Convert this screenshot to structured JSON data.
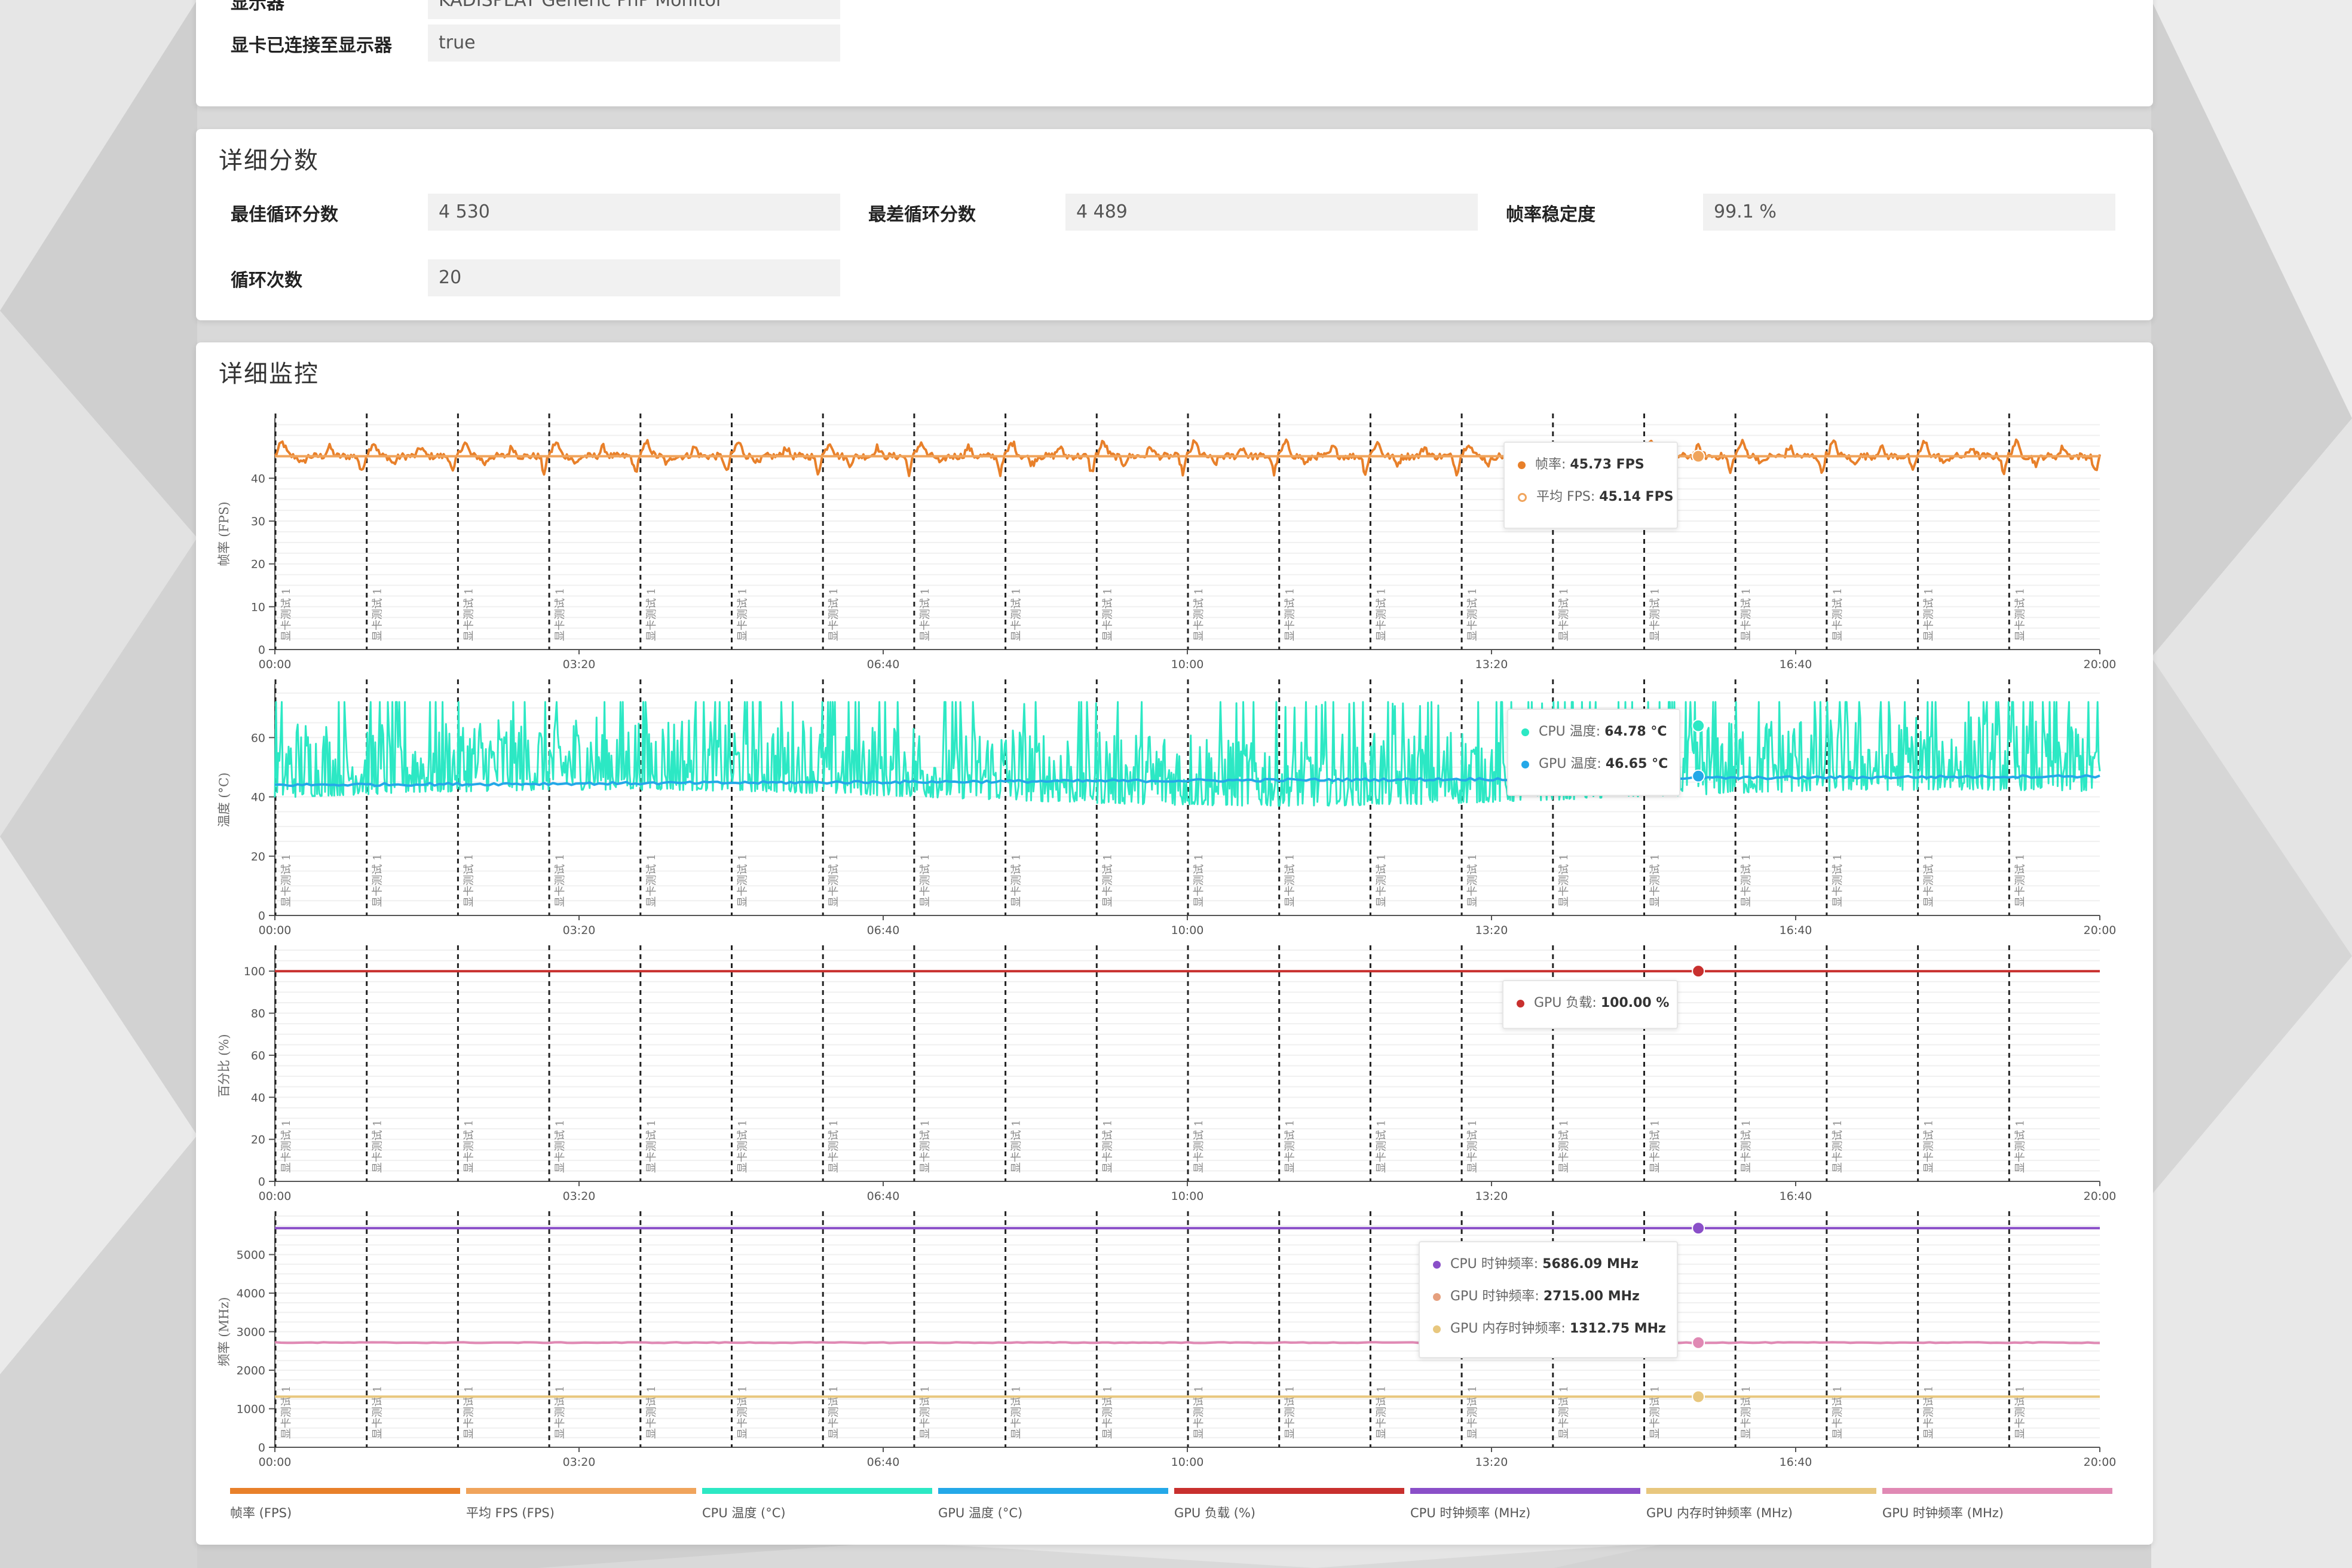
{
  "system_info": {
    "rows": [
      {
        "label": "显示器",
        "value": "KADISPLAY Generic PnP Monitor"
      },
      {
        "label": "显卡已连接至显示器",
        "value": "true"
      }
    ]
  },
  "detailed_scores": {
    "title": "详细分数",
    "fields": [
      {
        "label": "最佳循环分数",
        "value": "4 530"
      },
      {
        "label": "最差循环分数",
        "value": "4 489"
      },
      {
        "label": "帧率稳定度",
        "value": "99.1 %"
      },
      {
        "label": "循环次数",
        "value": "20"
      }
    ]
  },
  "monitoring": {
    "title": "详细监控",
    "marker_label": "显卡测试 1",
    "legend": [
      {
        "label": "帧率 (FPS)",
        "color": "#e8802a"
      },
      {
        "label": "平均 FPS (FPS)",
        "color": "#f0a45c"
      },
      {
        "label": "CPU 温度 (°C)",
        "color": "#2ce8c4"
      },
      {
        "label": "GPU 温度 (°C)",
        "color": "#24a8e8"
      },
      {
        "label": "GPU 负载 (%)",
        "color": "#c8302e"
      },
      {
        "label": "CPU 时钟频率 (MHz)",
        "color": "#8a4fc8"
      },
      {
        "label": "GPU 内存时钟频率 (MHz)",
        "color": "#e8c77e"
      },
      {
        "label": "GPU 时钟频率 (MHz)",
        "color": "#e089b4"
      }
    ],
    "tooltips": [
      {
        "rows": [
          {
            "name": "帧率",
            "value": "45.73 FPS",
            "color": "#e8802a",
            "ring": false
          },
          {
            "name": "平均 FPS",
            "value": "45.14 FPS",
            "color": "#f0a45c",
            "ring": true
          }
        ]
      },
      {
        "rows": [
          {
            "name": "CPU 温度",
            "value": "64.78 °C",
            "color": "#2ce8c4",
            "ring": false
          },
          {
            "name": "GPU 温度",
            "value": "46.65 °C",
            "color": "#24a8e8",
            "ring": false
          }
        ]
      },
      {
        "rows": [
          {
            "name": "GPU 负载",
            "value": "100.00 %",
            "color": "#c8302e",
            "ring": false
          }
        ]
      },
      {
        "rows": [
          {
            "name": "CPU 时钟频率",
            "value": "5686.09 MHz",
            "color": "#8a4fc8",
            "ring": false
          },
          {
            "name": "GPU 时钟频率",
            "value": "2715.00 MHz",
            "color": "#e6a07e",
            "ring": false
          },
          {
            "name": "GPU 内存时钟频率",
            "value": "1312.75 MHz",
            "color": "#e8c77e",
            "ring": false
          }
        ]
      }
    ]
  },
  "chart_data": [
    {
      "type": "line",
      "ylabel": "帧率 (FPS)",
      "ylim": [
        0,
        54
      ],
      "yticks": [
        0,
        10,
        20,
        30,
        40
      ],
      "xticks": [
        "00:00",
        "03:20",
        "06:40",
        "10:00",
        "13:20",
        "16:40",
        "20:00"
      ],
      "xlim_seconds": [
        0,
        1200
      ],
      "loop_markers_seconds": [
        0,
        60,
        120,
        180,
        240,
        300,
        360,
        420,
        480,
        540,
        600,
        660,
        720,
        780,
        840,
        900,
        960,
        1020,
        1080,
        1140
      ],
      "series": [
        {
          "name": "帧率",
          "color": "#e8802a",
          "pattern": "loop-wave",
          "mean": 45.14,
          "amplitude": 3.5
        },
        {
          "name": "平均 FPS",
          "color": "#f0a45c",
          "constant": 45.14
        }
      ],
      "hover_seconds": 936
    },
    {
      "type": "line",
      "ylabel": "温度 (°C)",
      "ylim": [
        0,
        78
      ],
      "yticks": [
        0,
        20,
        40,
        60
      ],
      "xticks": [
        "00:00",
        "03:20",
        "06:40",
        "10:00",
        "13:20",
        "16:40",
        "20:00"
      ],
      "xlim_seconds": [
        0,
        1200
      ],
      "loop_markers_seconds": [
        0,
        60,
        120,
        180,
        240,
        300,
        360,
        420,
        480,
        540,
        600,
        660,
        720,
        780,
        840,
        900,
        960,
        1020,
        1080,
        1140
      ],
      "series": [
        {
          "name": "CPU 温度",
          "color": "#2ce8c4",
          "pattern": "noisy",
          "low": 38,
          "high": 72
        },
        {
          "name": "GPU 温度",
          "color": "#24a8e8",
          "pattern": "slow-rise",
          "start": 44,
          "end": 47
        }
      ],
      "hover_seconds": 936
    },
    {
      "type": "line",
      "ylabel": "百分比 (%)",
      "ylim": [
        0,
        110
      ],
      "yticks": [
        0,
        20,
        40,
        60,
        80,
        100
      ],
      "xticks": [
        "00:00",
        "03:20",
        "06:40",
        "10:00",
        "13:20",
        "16:40",
        "20:00"
      ],
      "xlim_seconds": [
        0,
        1200
      ],
      "loop_markers_seconds": [
        0,
        60,
        120,
        180,
        240,
        300,
        360,
        420,
        480,
        540,
        600,
        660,
        720,
        780,
        840,
        900,
        960,
        1020,
        1080,
        1140
      ],
      "series": [
        {
          "name": "GPU 负载",
          "color": "#c8302e",
          "constant": 100
        }
      ],
      "hover_seconds": 936
    },
    {
      "type": "line",
      "ylabel": "频率 (MHz)",
      "ylim": [
        0,
        6000
      ],
      "yticks": [
        0,
        1000,
        2000,
        3000,
        4000,
        5000
      ],
      "xticks": [
        "00:00",
        "03:20",
        "06:40",
        "10:00",
        "13:20",
        "16:40",
        "20:00"
      ],
      "xlim_seconds": [
        0,
        1200
      ],
      "loop_markers_seconds": [
        0,
        60,
        120,
        180,
        240,
        300,
        360,
        420,
        480,
        540,
        600,
        660,
        720,
        780,
        840,
        900,
        960,
        1020,
        1080,
        1140
      ],
      "series": [
        {
          "name": "CPU 时钟频率",
          "color": "#8a4fc8",
          "constant": 5686.09
        },
        {
          "name": "GPU 时钟频率",
          "color": "#e089b4",
          "constant": 2715.0,
          "jitter": 20
        },
        {
          "name": "GPU 内存时钟频率",
          "color": "#e8c77e",
          "constant": 1312.75
        }
      ],
      "hover_seconds": 936
    }
  ]
}
